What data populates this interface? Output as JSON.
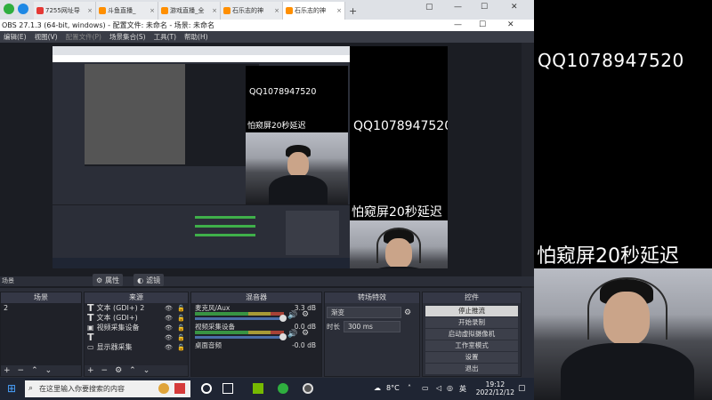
{
  "browser": {
    "tabs": [
      {
        "title": "7255网址导",
        "active": false
      },
      {
        "title": "斗鱼直播_",
        "active": false
      },
      {
        "title": "游戏直播_全",
        "active": false
      },
      {
        "title": "石乐志的神",
        "active": false
      },
      {
        "title": "石乐志的神",
        "active": true
      }
    ],
    "new_tab": "+"
  },
  "obs": {
    "title": "OBS 27.1.3 (64-bit, windows) - 配置文件: 未命名 - 场景: 未命名",
    "menu": [
      "编辑(E)",
      "视图(V)",
      "配置文件(P)",
      "场景集合(S)",
      "工具(T)",
      "帮助(H)"
    ],
    "status": "场景",
    "controls_bar": {
      "props_label": "属性",
      "filters_label": "滤镜"
    },
    "scenes": {
      "header": "场景",
      "items": [
        "2"
      ]
    },
    "sources": {
      "header": "来源",
      "items": [
        {
          "label": "文本 (GDI+) 2",
          "icon": "text-icon"
        },
        {
          "label": "文本 (GDI+)",
          "icon": "text-icon"
        },
        {
          "label": "视频采集设备",
          "icon": "camera-icon"
        },
        {
          "label": "",
          "icon": "text-icon"
        },
        {
          "label": "显示器采集",
          "icon": "monitor-icon"
        }
      ]
    },
    "mixer": {
      "header": "混音器",
      "items": [
        {
          "name": "麦克风/Aux",
          "level": "3.3 dB",
          "volume": 1.0
        },
        {
          "name": "视频采集设备",
          "level": "0.0 dB",
          "volume": 1.0
        },
        {
          "name": "桌面音频",
          "level": "-0.0 dB",
          "volume": 1.0
        }
      ]
    },
    "transitions": {
      "header": "转场特效",
      "type": "渐变",
      "duration_label": "时长",
      "duration": "300 ms"
    },
    "controls": {
      "header": "控件",
      "buttons": [
        "停止推流",
        "开始录制",
        "启动虚拟摄像机",
        "工作室模式",
        "设置",
        "退出"
      ]
    }
  },
  "overlay": {
    "qq": "QQ1078947520",
    "delay": "怕窥屏20秒延迟"
  },
  "taskbar": {
    "search_placeholder": "在这里输入你要搜索的内容",
    "weather": "8°C",
    "ime": "英",
    "time": "19:12",
    "date": "2022/12/12"
  },
  "colors": {
    "accent_green": "#2fae3f",
    "obs_bg": "#2b2e38",
    "meter_green": "#3fb04a"
  }
}
